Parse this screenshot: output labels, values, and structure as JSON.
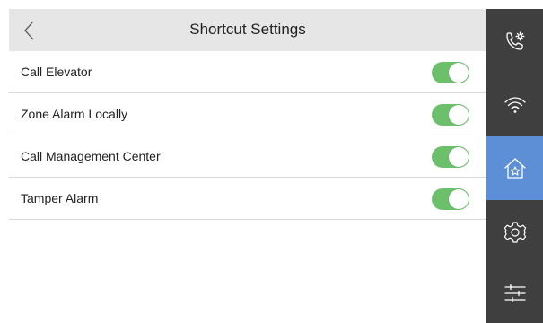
{
  "header": {
    "title": "Shortcut Settings",
    "back_icon": "chevron-left-icon"
  },
  "settings": [
    {
      "label": "Call Elevator",
      "enabled": true
    },
    {
      "label": "Zone Alarm Locally",
      "enabled": true
    },
    {
      "label": "Call Management Center",
      "enabled": true
    },
    {
      "label": "Tamper Alarm",
      "enabled": true
    }
  ],
  "sidebar": {
    "items": [
      {
        "icon": "phone-settings-icon",
        "active": false
      },
      {
        "icon": "wifi-icon",
        "active": false
      },
      {
        "icon": "home-star-icon",
        "active": true
      },
      {
        "icon": "gear-icon",
        "active": false
      },
      {
        "icon": "sliders-icon",
        "active": false
      }
    ]
  },
  "colors": {
    "toggle_on": "#6cc06c",
    "sidebar_bg": "#3f3f3f",
    "sidebar_active": "#5c8fd6",
    "header_bg": "#e6e6e6"
  }
}
